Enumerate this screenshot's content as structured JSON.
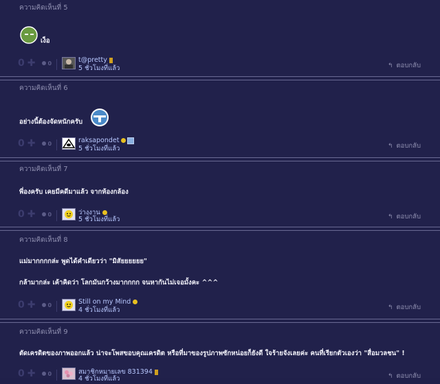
{
  "comments": [
    {
      "header": "ความคิดเห็นที่ 5",
      "lines": [
        "เง็อ"
      ],
      "votes_up": "0",
      "votes_down": "0",
      "username": "t@pretty",
      "time": "5 ชั่วโมงที่แล้ว",
      "reply": "ตอบกลับ",
      "avatar_icon": "photo-avatar",
      "emoticon": "green-face-icon"
    },
    {
      "header": "ความคิดเห็นที่ 6",
      "lines": [
        "อย่างนี้ต้องจัดหนักครับ"
      ],
      "votes_up": "0",
      "votes_down": "0",
      "username": "raksapondet",
      "time": "5 ชั่วโมงที่แล้ว",
      "reply": "ตอบกลับ",
      "avatar_icon": "eye-avatar",
      "emoticon": "blue-face-icon"
    },
    {
      "header": "ความคิดเห็นที่ 7",
      "lines": [
        "พี่องครับ เคยมีคดีมาแล้ว จากห้องกล้อง"
      ],
      "votes_up": "0",
      "votes_down": "0",
      "username": "ว่างงาน",
      "time": "5 ชั่วโมงที่แล้ว",
      "reply": "ตอบกลับ",
      "avatar_icon": "smiley-avatar"
    },
    {
      "header": "ความคิดเห็นที่ 8",
      "lines": [
        "แม่มากกกกล่ะ พูดได้คำเดียวว่า \"มิสัยยยยยย\"",
        "กล้ามากล่ะ เค้าคิดว่า โลกมันกว้างมากกกก จนหากันไม่เจอมั้งคะ ^^^"
      ],
      "votes_up": "0",
      "votes_down": "0",
      "username": "Still on my Mind",
      "time": "4 ชั่วโมงที่แล้ว",
      "reply": "ตอบกลับ",
      "avatar_icon": "smiley-avatar"
    },
    {
      "header": "ความคิดเห็นที่ 9",
      "lines": [
        "ตัดเครดิตของภาพออกแล้ว น่าจะโพสขอบคุณเครดิต หรือที่มาของรูปภาพซักหน่อยก็ยังดี ใจร้ายจังเลยค่ะ คนที่เรียกตัวเองว่า \"สื่อมวลชน\" !"
      ],
      "votes_up": "0",
      "votes_down": "0",
      "username": "สมาชิกหมายเลข 831394",
      "time": "4 ชั่วโมงที่แล้ว",
      "reply": "ตอบกลับ",
      "avatar_icon": "flower-avatar"
    }
  ]
}
